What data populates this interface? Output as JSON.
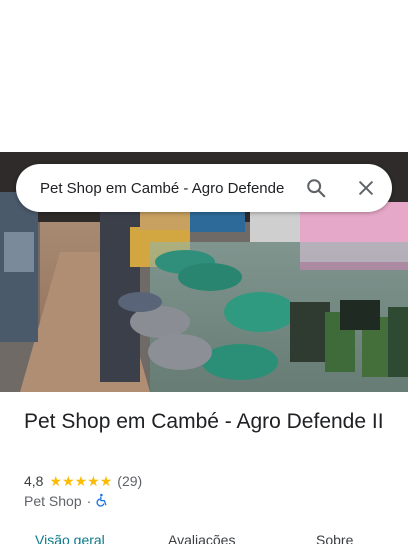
{
  "search": {
    "query": "Pet Shop em Cambé - Agro Defende"
  },
  "place": {
    "title": "Pet Shop em Cambé - Agro Defende II",
    "rating": "4,8",
    "stars": 4.8,
    "reviews_count": "(29)",
    "category": "Pet Shop",
    "separator": "·"
  },
  "tabs": [
    {
      "label": "Visão geral",
      "active": true
    },
    {
      "label": "Avaliações",
      "active": false
    },
    {
      "label": "Sobre",
      "active": false
    }
  ],
  "icons": [
    "search-icon",
    "close-icon",
    "star-icon",
    "wheelchair-icon"
  ],
  "colors": {
    "active_tab": "#0b7a8a",
    "star": "#fbbc04",
    "accessibility": "#1a73e8"
  }
}
